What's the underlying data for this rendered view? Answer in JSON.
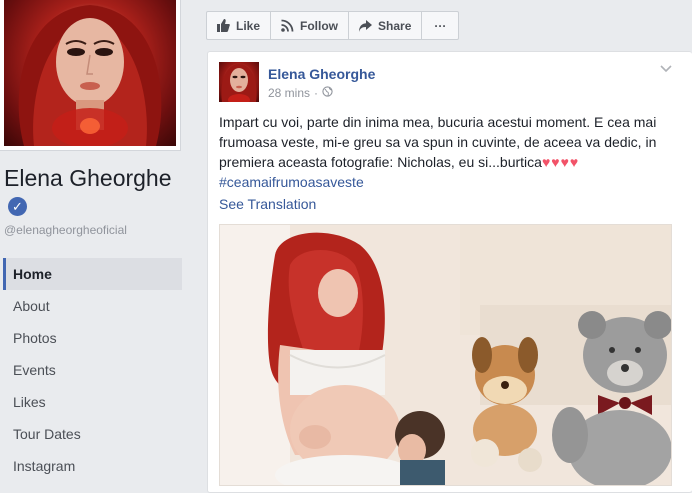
{
  "page": {
    "name": "Elena Gheorghe",
    "handle": "@elenagheorgheoficial",
    "verified": true
  },
  "nav": {
    "items": [
      {
        "label": "Home",
        "active": true
      },
      {
        "label": "About",
        "active": false
      },
      {
        "label": "Photos",
        "active": false
      },
      {
        "label": "Events",
        "active": false
      },
      {
        "label": "Likes",
        "active": false
      },
      {
        "label": "Tour Dates",
        "active": false
      },
      {
        "label": "Instagram",
        "active": false
      }
    ]
  },
  "actions": {
    "like_label": "Like",
    "follow_label": "Follow",
    "share_label": "Share",
    "more_label": "···"
  },
  "post": {
    "author": "Elena Gheorghe",
    "time": "28 mins",
    "separator": "·",
    "privacy_icon": "globe-icon",
    "text": "Impart cu voi, parte din inima mea, bucuria acestui moment. E cea mai frumoasa veste, mi-e greu sa va spun in cuvinte, de aceea va dedic, in premiera aceasta fotografie: Nicholas, eu si...burtica",
    "hearts": "♥♥♥♥",
    "hashtag": "#ceamaifrumoasaveste",
    "see_translation": "See Translation"
  },
  "colors": {
    "link_blue": "#365899",
    "verified_blue": "#4267b2",
    "background": "#e9ebee",
    "heart_pink": "#f25268"
  }
}
